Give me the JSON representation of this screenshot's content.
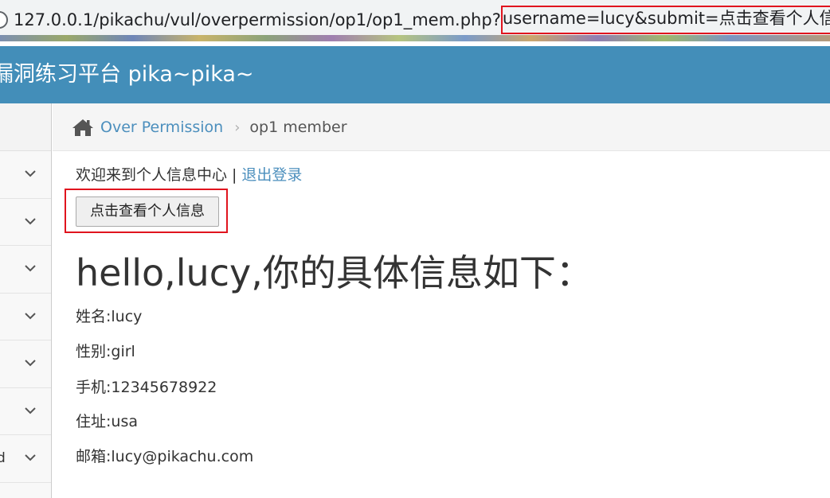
{
  "browser": {
    "url_base": "127.0.0.1/pikachu/vul/overpermission/op1/op1_mem.php?",
    "url_query": "username=lucy&submit=点击查看个人信息"
  },
  "header": {
    "title": "漏洞练习平台 pika~pika~"
  },
  "sidebar": {
    "items": [
      {
        "label": ""
      },
      {
        "label": ""
      },
      {
        "label": ""
      },
      {
        "label": ""
      },
      {
        "label": ""
      },
      {
        "label": ""
      },
      {
        "label": "d"
      }
    ]
  },
  "breadcrumb": {
    "parent": "Over Permission",
    "current": "op1 member"
  },
  "main": {
    "welcome": "欢迎来到个人信息中心",
    "divider": "|",
    "logout": "退出登录",
    "view_button": "点击查看个人信息",
    "info_title": "hello,lucy,你的具体信息如下：",
    "fields": {
      "name": "姓名:lucy",
      "gender": "性别:girl",
      "phone": "手机:12345678922",
      "address": "住址:usa",
      "email": "邮箱:lucy@pikachu.com"
    }
  },
  "colors": {
    "header_bg": "#438eb9",
    "link": "#4c8fbd",
    "highlight_box": "#e0141e"
  }
}
